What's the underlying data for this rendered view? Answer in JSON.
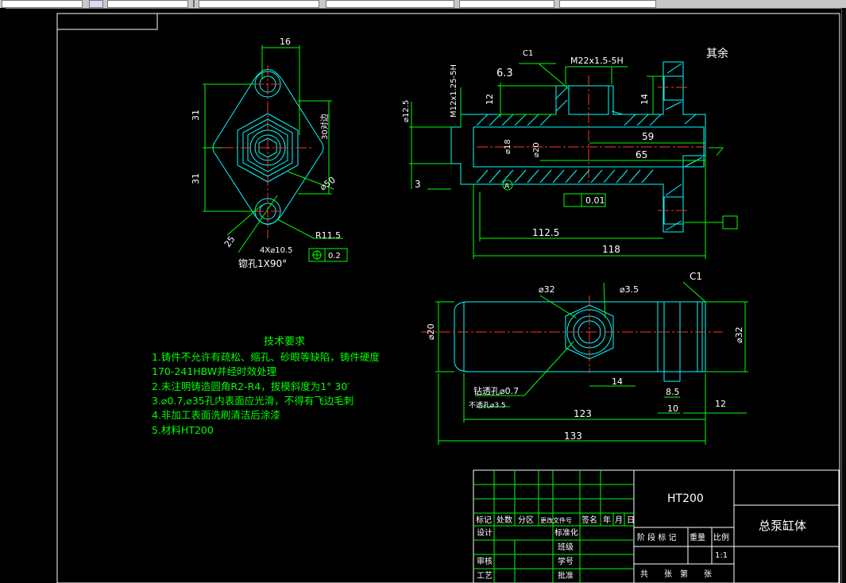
{
  "drawing": {
    "finish_note": "其余",
    "top_view": {
      "dim_width": "16",
      "dim_upper": "31",
      "dim_lower": "31",
      "dim_hex": "30对边",
      "dim_circle": "⌀50",
      "dim_radius": "R11.5",
      "dim_angle": "25",
      "dim_holes": "4X⌀10.5",
      "countersink": "锪孔1X90°",
      "position_tol": "0.2"
    },
    "section_view": {
      "chamfer": "C1",
      "thread_main": "M22x1.5-5H",
      "roughness_a": "6.3",
      "dim_12": "12",
      "dim_14": "14",
      "thread_side": "M12x1.25-5H",
      "dim_d125": "⌀12.5",
      "dim_d18": "⌀18",
      "dim_d20": "⌀20",
      "dim_59": "59",
      "dim_65": "65",
      "dim_3": "3",
      "datum": "A",
      "flatness": "0.01",
      "dim_1125": "112.5",
      "dim_118": "118"
    },
    "side_view": {
      "dim_d32_top": "⌀32",
      "dim_d35": "⌀3.5",
      "chamfer": "C1",
      "dim_d20": "⌀20",
      "dim_d32": "⌀32",
      "dim_14": "14",
      "drill_note": "钻透孔⌀0.7",
      "blind_note": "不透孔⌀3.5",
      "dim_85": "8.5",
      "dim_10": "10",
      "dim_12": "12",
      "dim_123": "123",
      "dim_133": "133"
    },
    "tech_requirements": {
      "title": "技术要求",
      "lines": [
        "1.铸件不允许有疏松、缩孔、砂眼等缺陷，铸件硬度",
        "170-241HBW并经时效处理",
        "2.未注明铸造圆角R2-R4，拔模斜度为1° 30′",
        "3.⌀0.7,⌀35孔内表面应光滑，不得有飞边毛刺",
        "4.非加工表面洗刷清洁后涂漆",
        "5.材料HT200"
      ]
    },
    "title_block": {
      "material": "HT200",
      "part_name": "总泵缸体",
      "header_cells": [
        "标记",
        "处数",
        "分区",
        "更改文件号",
        "签名",
        "年",
        "月",
        "日"
      ],
      "design": "设计",
      "standard": "标准化",
      "class": "班级",
      "review": "审核",
      "student_id": "学号",
      "process": "工艺",
      "approve": "批准",
      "stage": "阶 段 标 记",
      "weight": "重量",
      "scale": "比例",
      "scale_value": "1:1",
      "sheets": "共　　张　第　　张"
    }
  }
}
